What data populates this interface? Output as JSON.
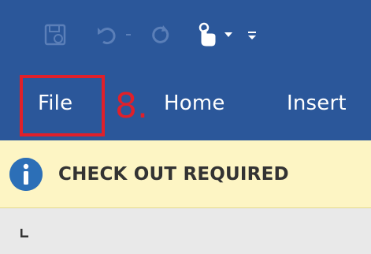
{
  "quick_access": {
    "buttons": [
      {
        "name": "save-icon"
      },
      {
        "name": "undo-icon"
      },
      {
        "name": "undo-dropdown-icon"
      },
      {
        "name": "redo-icon"
      },
      {
        "name": "touch-mode-icon"
      },
      {
        "name": "touch-mode-dropdown-icon"
      },
      {
        "name": "customize-qat-icon"
      }
    ]
  },
  "ribbon": {
    "tabs": [
      {
        "label": "File"
      },
      {
        "label": "Home"
      },
      {
        "label": "Insert"
      }
    ]
  },
  "annotation": {
    "step": "8.",
    "color": "#e0202a"
  },
  "message_bar": {
    "icon": "info-icon",
    "text": "CHECK OUT REQUIRED"
  },
  "ruler": {
    "tab_stop_icon": "left-tab-stop-icon"
  },
  "colors": {
    "ribbon": "#2b579a",
    "message_bar": "#fdf5c4",
    "info": "#2c6fb7"
  }
}
